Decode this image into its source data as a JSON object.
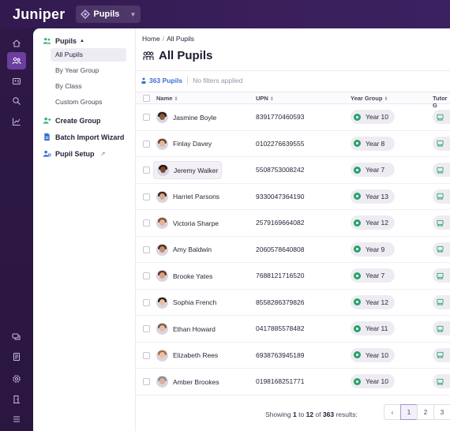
{
  "app": {
    "name": "Juniper",
    "module": "Pupils"
  },
  "colors": {
    "rail_bg": "#2e1946",
    "active": "#6b3fa0",
    "year_dot": "#29a36a",
    "count_link": "#3b6fd6"
  },
  "rail": {
    "items": [
      {
        "icon": "home-icon"
      },
      {
        "icon": "people-icon",
        "active": true
      },
      {
        "icon": "id-card-icon"
      },
      {
        "icon": "search-icon"
      },
      {
        "icon": "chart-icon"
      },
      {
        "icon": "chat-icon"
      },
      {
        "icon": "document-icon"
      },
      {
        "icon": "gear-icon"
      },
      {
        "icon": "door-icon"
      },
      {
        "icon": "menu-icon"
      }
    ]
  },
  "subnav": {
    "pupils_label": "Pupils",
    "items": [
      "All Pupils",
      "By Year Group",
      "By Class",
      "Custom Groups"
    ],
    "create_group": "Create Group",
    "batch_import": "Batch Import Wizard",
    "pupil_setup": "Pupil Setup"
  },
  "breadcrumb": {
    "home": "Home",
    "current": "All Pupils"
  },
  "page_title": "All Pupils",
  "summary": {
    "count": "363 Pupils",
    "filters": "No filters applied"
  },
  "columns": {
    "name": "Name",
    "upn": "UPN",
    "year": "Year Group",
    "tutor": "Tutor G"
  },
  "rows": [
    {
      "name": "Jasmine Boyle",
      "upn": "8391770460593",
      "year": "Year 10",
      "skin": "#8a5a3c",
      "hair": "#2b1a12"
    },
    {
      "name": "Finlay Davey",
      "upn": "0102276639555",
      "year": "Year 8",
      "skin": "#e2b79a",
      "hair": "#6a3f24"
    },
    {
      "name": "Jeremy Walker",
      "upn": "5508753008242",
      "year": "Year 7",
      "skin": "#7a4a2e",
      "hair": "#1e120c"
    },
    {
      "name": "Harriet Parsons",
      "upn": "9330047364190",
      "year": "Year 13",
      "skin": "#d9a98a",
      "hair": "#3a2416"
    },
    {
      "name": "Victoria Sharpe",
      "upn": "2579169664082",
      "year": "Year 12",
      "skin": "#e0b49a",
      "hair": "#8a4a2a"
    },
    {
      "name": "Amy Baldwin",
      "upn": "2060578640808",
      "year": "Year 9",
      "skin": "#c48e6c",
      "hair": "#4a2a18"
    },
    {
      "name": "Brooke Yates",
      "upn": "7688121716520",
      "year": "Year 7",
      "skin": "#d8a282",
      "hair": "#5a3420"
    },
    {
      "name": "Sophia French",
      "upn": "8558286379826",
      "year": "Year 12",
      "skin": "#e6c0a4",
      "hair": "#2a1a10"
    },
    {
      "name": "Ethan Howard",
      "upn": "0417885578482",
      "year": "Year 11",
      "skin": "#e4bea2",
      "hair": "#7a5a40"
    },
    {
      "name": "Elizabeth Rees",
      "upn": "6938763945189",
      "year": "Year 10",
      "skin": "#e8c2a8",
      "hair": "#a86a3a"
    },
    {
      "name": "Amber Brookes",
      "upn": "0198168251771",
      "year": "Year 10",
      "skin": "#d6b4a0",
      "hair": "#8a8a90"
    }
  ],
  "footer": {
    "showing_prefix": "Showing",
    "from": "1",
    "to_word": "to",
    "to": "12",
    "of_word": "of",
    "total": "363",
    "suffix": "results:"
  },
  "pager": {
    "prev": "‹",
    "pages": [
      "1",
      "2",
      "3"
    ]
  }
}
